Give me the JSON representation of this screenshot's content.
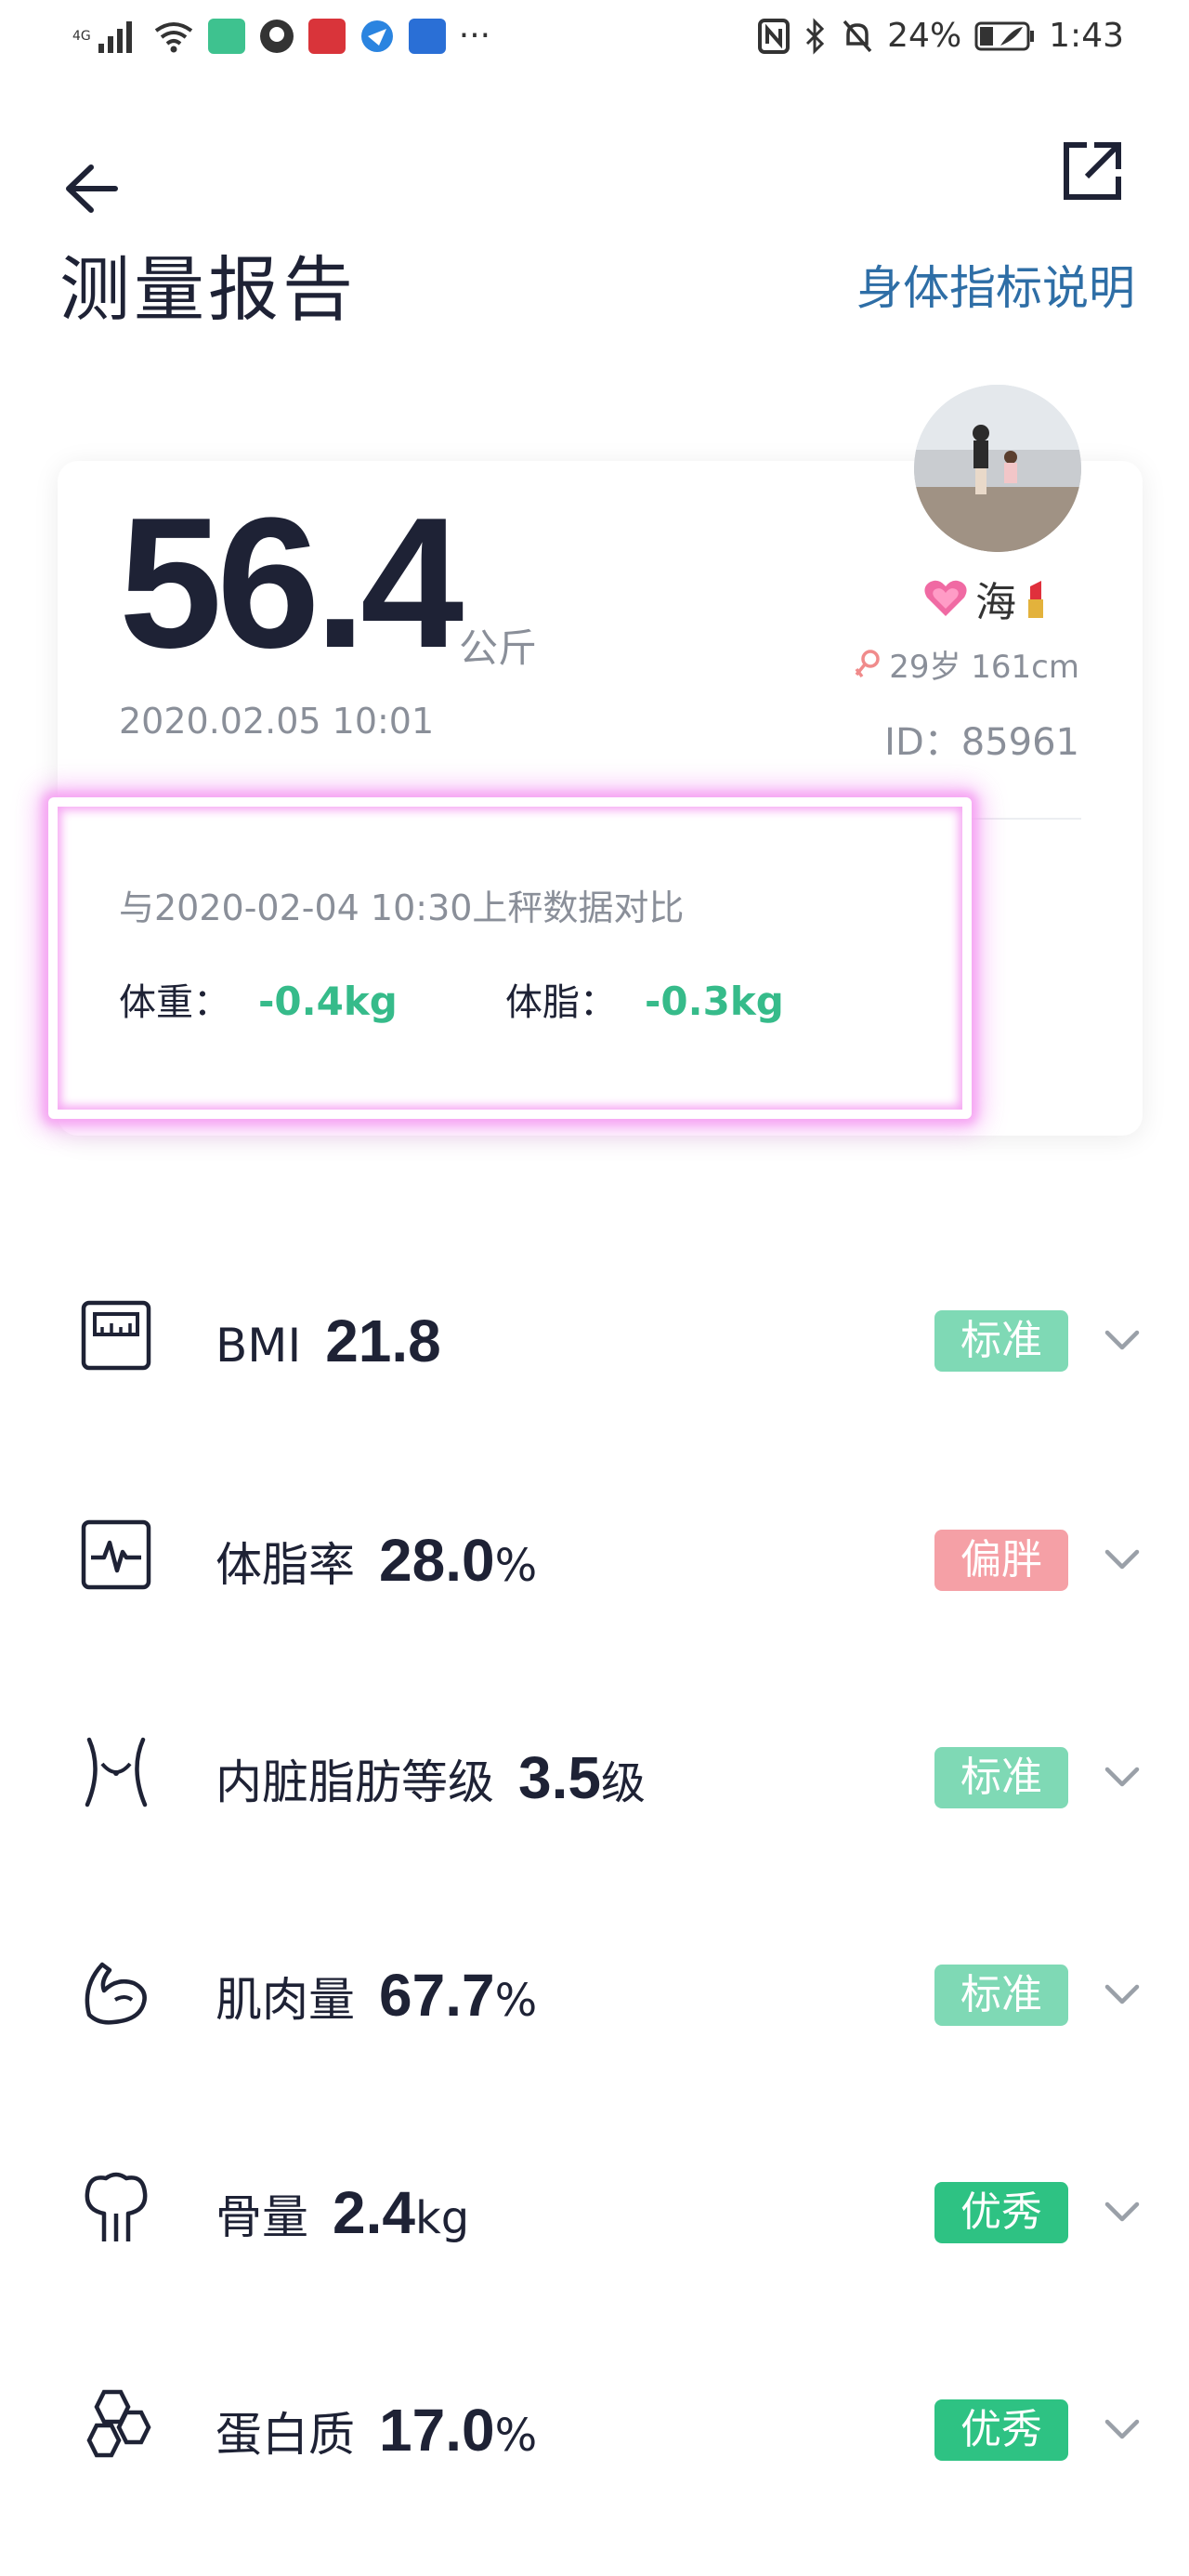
{
  "status_bar": {
    "network": "4G",
    "battery": "24%",
    "time": "1:43"
  },
  "header": {
    "title": "测量报告",
    "explain_link": "身体指标说明"
  },
  "summary": {
    "weight": "56.4",
    "unit": "公斤",
    "datetime": "2020.02.05 10:01",
    "user": {
      "name": "海",
      "age_height": "29岁 161cm",
      "id": "ID：85961"
    }
  },
  "compare": {
    "title": "与2020-02-04 10:30上秤数据对比",
    "weight_label": "体重：",
    "weight_delta": "-0.4kg",
    "fat_label": "体脂：",
    "fat_delta": "-0.3kg"
  },
  "colors": {
    "accent_blue": "#2e6ea6",
    "delta_green": "#36bb8a",
    "badge_standard": "#7fd9b5",
    "badge_fat": "#f5a0a6",
    "badge_excellent": "#2ec283"
  },
  "metrics": [
    {
      "icon": "scale-icon",
      "name": "BMI",
      "value": "21.8",
      "unit": "",
      "badge": "标准",
      "badge_color": "#7fd9b5"
    },
    {
      "icon": "heart-rate-icon",
      "name": "体脂率",
      "value": "28.0",
      "unit": "%",
      "badge": "偏胖",
      "badge_color": "#f5a0a6"
    },
    {
      "icon": "waist-icon",
      "name": "内脏脂肪等级",
      "value": "3.5",
      "unit": "级",
      "badge": "标准",
      "badge_color": "#7fd9b5"
    },
    {
      "icon": "muscle-icon",
      "name": "肌肉量",
      "value": "67.7",
      "unit": "%",
      "badge": "标准",
      "badge_color": "#7fd9b5"
    },
    {
      "icon": "bone-icon",
      "name": "骨量",
      "value": "2.4",
      "unit": "kg",
      "badge": "优秀",
      "badge_color": "#2ec283"
    },
    {
      "icon": "protein-icon",
      "name": "蛋白质",
      "value": "17.0",
      "unit": "%",
      "badge": "优秀",
      "badge_color": "#2ec283"
    }
  ]
}
